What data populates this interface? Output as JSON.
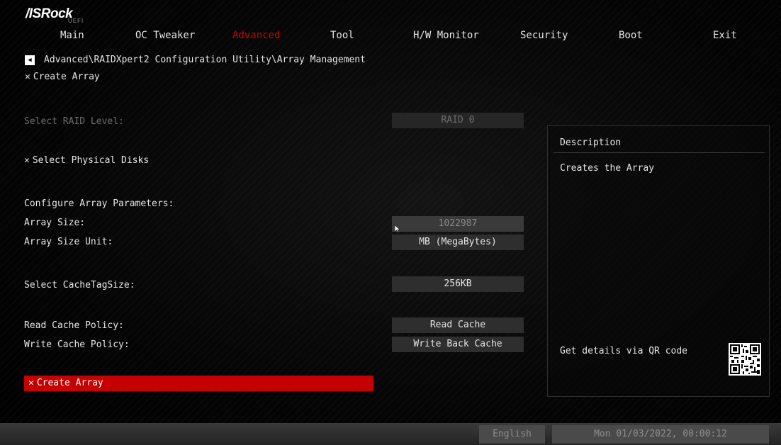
{
  "brand": {
    "logo": "/ISRock",
    "subtitle": "UEFI"
  },
  "tabs": [
    {
      "label": "Main",
      "active": false
    },
    {
      "label": "OC Tweaker",
      "active": false
    },
    {
      "label": "Advanced",
      "active": true
    },
    {
      "label": "Tool",
      "active": false
    },
    {
      "label": "H/W Monitor",
      "active": false
    },
    {
      "label": "Security",
      "active": false
    },
    {
      "label": "Boot",
      "active": false
    },
    {
      "label": "Exit",
      "active": false
    }
  ],
  "breadcrumb": {
    "back_icon": "back-arrow-icon",
    "path": "Advanced\\RAIDXpert2 Configuration Utility\\Array Management"
  },
  "page_title": {
    "icon": "tools-icon",
    "label": "Create Array"
  },
  "settings": {
    "raid_level": {
      "label": "Select RAID Level:",
      "value": "RAID 0",
      "enabled": false
    },
    "physical_disks": {
      "icon": "tools-icon",
      "label": "Select Physical Disks"
    },
    "params_heading": "Configure Array Parameters:",
    "array_size": {
      "label": "Array Size:",
      "value": "1022987"
    },
    "array_size_unit": {
      "label": "Array Size Unit:",
      "value": "MB (MegaBytes)"
    },
    "cache_tag_size": {
      "label": "Select CacheTagSize:",
      "value": "256KB"
    },
    "read_cache": {
      "label": "Read Cache Policy:",
      "value": "Read Cache"
    },
    "write_cache": {
      "label": "Write Cache Policy:",
      "value": "Write Back Cache"
    },
    "create_button": {
      "icon": "tools-icon",
      "label": "Create Array"
    }
  },
  "description": {
    "title": "Description",
    "text": "Creates the Array",
    "qr_label": "Get details via QR code",
    "qr_icon": "qr-code-icon"
  },
  "status_bar": {
    "language": "English",
    "datetime": "Mon 01/03/2022, 00:00:12"
  },
  "colors": {
    "accent": "#c40000",
    "active_tab": "#d40000",
    "background": "#000000"
  }
}
